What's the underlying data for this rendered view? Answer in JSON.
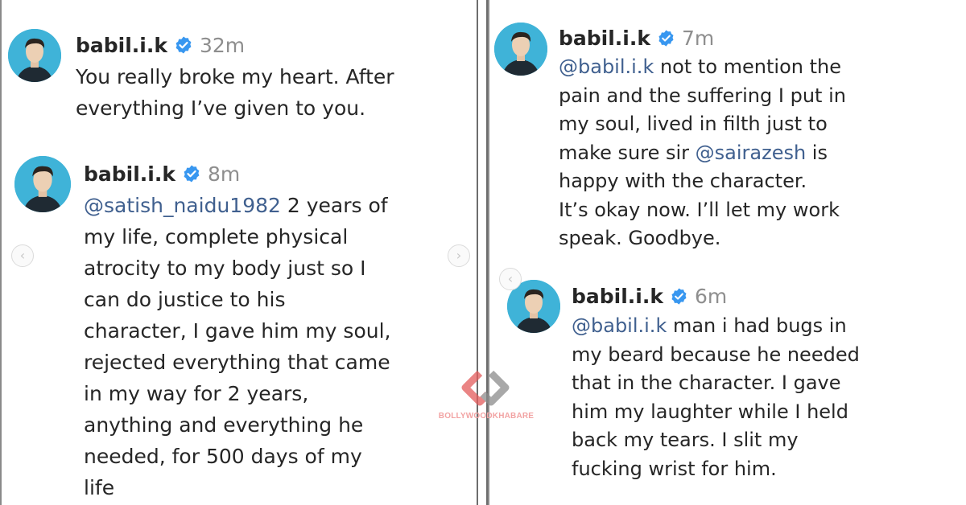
{
  "colors": {
    "mention": "#40608f",
    "verified_badge": "#3897f0",
    "timestamp": "#8e8e8e",
    "text": "#262626",
    "avatar_bg": "#3fb3d8",
    "watermark": "#e35b5b"
  },
  "left_panel": {
    "comments": [
      {
        "username": "babil.i.k",
        "verified_icon": "verified-badge-icon",
        "time": "32m",
        "lines": [
          "You really broke my heart. After",
          "everything I’ve given to you."
        ]
      },
      {
        "username": "babil.i.k",
        "verified_icon": "verified-badge-icon",
        "time": "8m",
        "mention": "@satish_naidu1982",
        "first_line_rest": " 2 years of",
        "lines": [
          "my life, complete physical",
          "atrocity to my body just so I",
          "can do justice to his",
          "character, I gave him my soul,",
          "rejected everything that came",
          "in my way for 2 years,",
          "anything and everything he",
          "needed, for 500 days of my",
          "life"
        ]
      }
    ],
    "nav": {
      "prev": "‹",
      "next": "›"
    }
  },
  "right_panel": {
    "comments": [
      {
        "username": "babil.i.k",
        "verified_icon": "verified-badge-icon",
        "time": "7m",
        "mention": "@babil.i.k",
        "first_line_rest": " not to mention the",
        "line2": "pain and the suffering I put in",
        "line3": "my soul, lived in filth just to",
        "line4_pre": "make sure sir ",
        "line4_mention": "@sairazesh",
        "line4_post": " is",
        "line5": "happy with the character.",
        "line6": "It’s okay now. I’ll let my work",
        "line7": "speak. Goodbye."
      },
      {
        "username": "babil.i.k",
        "verified_icon": "verified-badge-icon",
        "time": "6m",
        "mention": "@babil.i.k",
        "first_line_rest": " man i had bugs in",
        "lines": [
          "my beard because he needed",
          "that in the character. I gave",
          "him my laughter while I held",
          "back my tears. I slit my",
          "fucking wrist for him."
        ]
      }
    ],
    "nav": {
      "prev": "‹"
    }
  },
  "watermark": {
    "text": "BOLLYWOODKHABARE",
    "logo_icon": "bollywood-khabare-logo-icon"
  }
}
